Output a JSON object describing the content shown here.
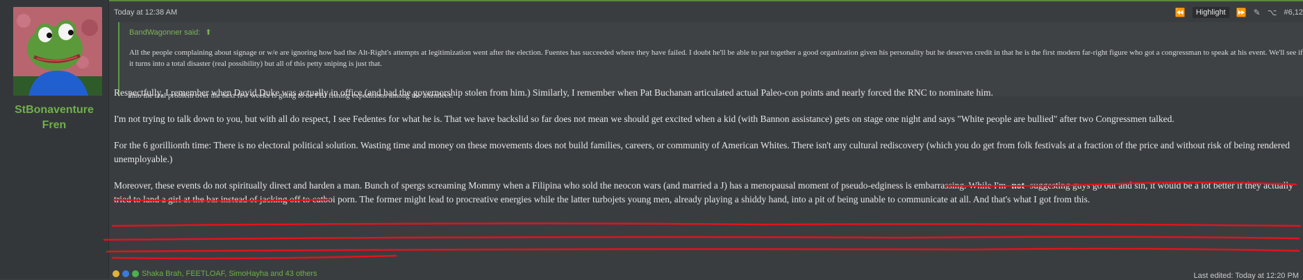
{
  "user": {
    "name": "StBonaventure",
    "title": "Fren"
  },
  "post": {
    "timestamp": "Today at 12:38 AM",
    "highlight_label": "Highlight",
    "post_number": "#6,12"
  },
  "quote": {
    "author_line": "BandWagonner said:",
    "paragraph1": "All the people complaining about signage or w/e are ignoring how bad the Alt-Right's attempts at legitimization went after the election. Fuentes has succeeded where they have failed. I doubt he'll be able to put together a good organization given his personality but he deserves credit in that he is the first modern far-right figure who got a congressman to speak at his event. We'll see if it turns into a total disaster (real possibility) but all of this petty sniping is just that.",
    "paragraph2": "Imo the real problem over the next few weeks is going to be FBI fishing expeditions among the attendees."
  },
  "body": {
    "p1": "Respectfully, I remember when David Duke was actually in office (and had the governorship stolen from him.) Similarly, I remember when Pat Buchanan articulated actual Paleo-con points and nearly forced the RNC to nominate him.",
    "p2": "I'm not trying to talk down to you, but with all do respect, I see Fedentes for what he is. That we have backslid so far does not mean we should get excited when a kid (with Bannon assistance) gets on stage one night and says \"White people are bullied\" after two Congressmen talked.",
    "p3": "For the 6 gorillionth time: There is no electoral political solution. Wasting time and money on these movements does not build families, careers, or community of American Whites. There isn't any cultural rediscovery (which you do get from folk festivals at a fraction of the price and without risk of being rendered unemployable.)",
    "p4_before": "Moreover, these events do not spiritually direct and harden a man. Bunch of spergs screaming Mommy when a Filipina who sold the neocon wars (and married a J) has a menopausal moment of pseudo-edginess is embarrassing. While I'm -",
    "p4_bold": "not",
    "p4_after": "- suggesting guys go out and sin, it would be a lot better if they actually tried to land a girl at the bar instead of jacking off to catboi porn. The former might lead to procreative energies while the latter turbojets young men, already playing a shiddy hand, into a pit of being unable to communicate at all. And that's what I got from this."
  },
  "reactions": {
    "text": "Shaka Brah, FEETLOAF, SimoHayha and 43 others"
  },
  "edited": "Last edited: Today at 12:20 PM",
  "colors": {
    "accent": "#6fb04a",
    "annotation": "#e0141e",
    "background": "#3a3d40"
  },
  "icons": [
    "rewind-icon",
    "fast-forward-icon",
    "pencil-icon",
    "share-icon",
    "bookmark-icon",
    "arrow-circle-up-icon"
  ]
}
